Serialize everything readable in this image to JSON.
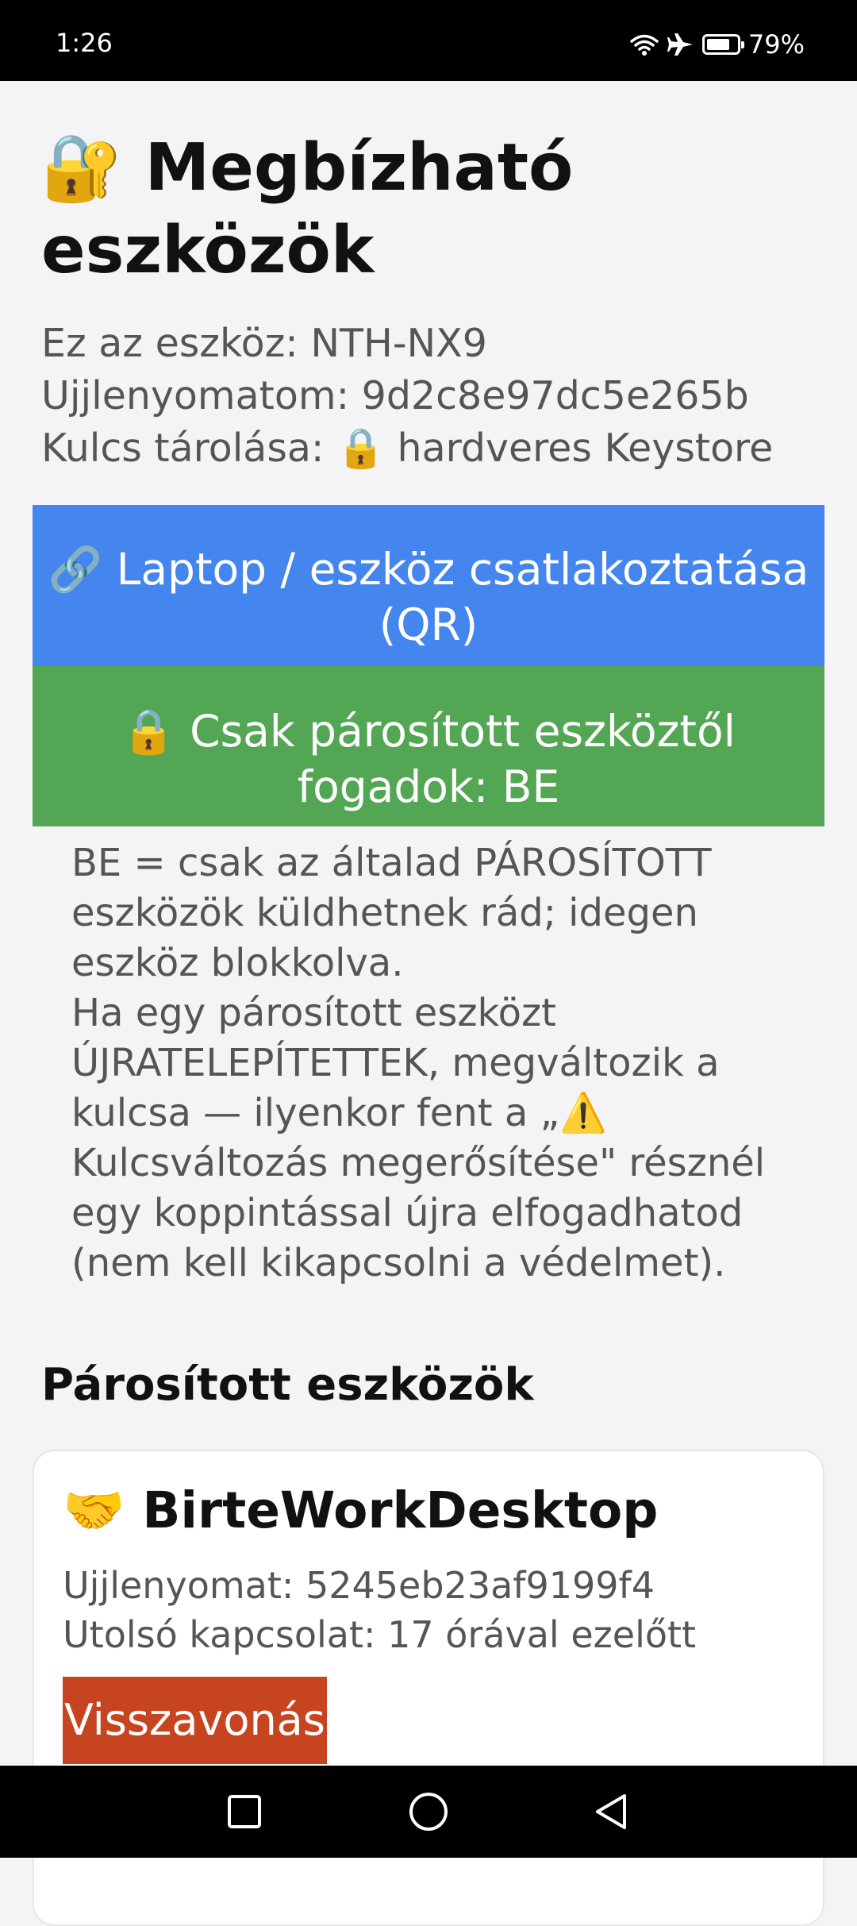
{
  "status_bar": {
    "time": "1:26",
    "battery_percent": "79%",
    "battery_level": 0.79
  },
  "header": {
    "title_emoji": "🔐",
    "title_text": "Megbízható eszközök"
  },
  "device_info": {
    "device_line": "Ez az eszköz: NTH-NX9",
    "fingerprint_line": "Ujjlenyomatom: 9d2c8e97dc5e265b",
    "key_storage_line": "Kulcs tárolása: 🔒 hardveres Keystore"
  },
  "actions": {
    "connect_label": "🔗 Laptop / eszköz csatlakoztatása (QR)",
    "paired_only_label": "🔒 Csak párosított eszköztől fogadok: BE"
  },
  "explanation": {
    "paragraph1": "BE = csak az általad PÁROSÍTOTT eszközök küldhetnek rád; idegen eszköz blokkolva.",
    "paragraph2": "Ha egy párosított eszközt ÚJRATELEPÍTETTEK, megváltozik a kulcsa — ilyenkor fent a „⚠️ Kulcsváltozás megerősítése\" résznél egy koppintással újra elfogadhatod (nem kell kikapcsolni a védelmet)."
  },
  "paired_section": {
    "title": "Párosított eszközök",
    "devices": [
      {
        "emoji": "🤝",
        "name": "BirteWorkDesktop",
        "fingerprint_line": "Ujjlenyomat: 5245eb23af9199f4",
        "last_seen_line": "Utolsó kapcsolat: 17 órával ezelőtt",
        "revoke_label": "Visszavonás"
      }
    ]
  },
  "colors": {
    "connect_button": "#4485ee",
    "paired_only_button": "#53a654",
    "revoke_button": "#c64520",
    "background": "#f4f4f6"
  },
  "icons": [
    "wifi-icon",
    "airplane-icon",
    "battery-icon",
    "nav-recents-icon",
    "nav-home-icon",
    "nav-back-icon"
  ]
}
